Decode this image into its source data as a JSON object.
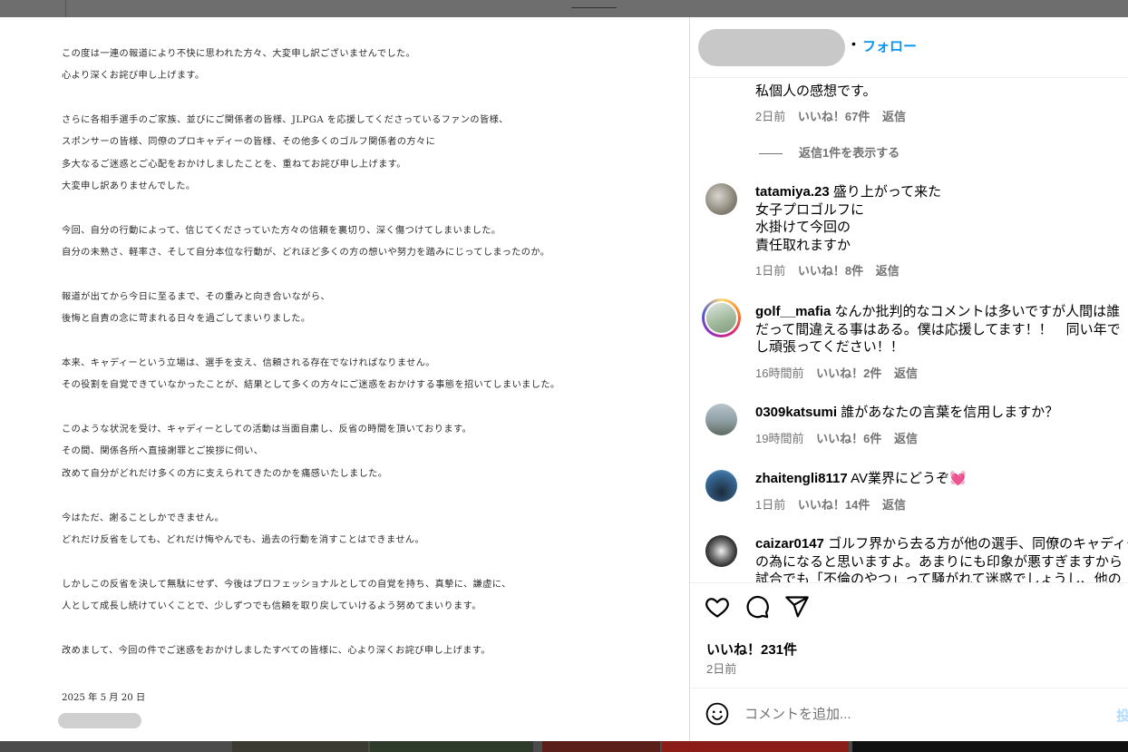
{
  "document": {
    "paragraphs": [
      [
        "この度は一連の報道により不快に思われた方々、大変申し訳ございませんでした。",
        "心より深くお詫び申し上げます。"
      ],
      [
        "さらに各相手選手のご家族、並びにご関係者の皆様、JLPGA を応援してくださっているファンの皆様、",
        "スポンサーの皆様、同僚のプロキャディーの皆様、その他多くのゴルフ関係者の方々に",
        "多大なるご迷惑とご心配をおかけしましたことを、重ねてお詫び申し上げます。",
        "大変申し訳ありませんでした。"
      ],
      [
        "今回、自分の行動によって、信じてくださっていた方々の信頼を裏切り、深く傷つけてしまいました。",
        "自分の未熟さ、軽率さ、そして自分本位な行動が、どれほど多くの方の想いや努力を踏みにじってしまったのか。"
      ],
      [
        "報道が出てから今日に至るまで、その重みと向き合いながら、",
        "後悔と自責の念に苛まれる日々を過ごしてまいりました。"
      ],
      [
        "本来、キャディーという立場は、選手を支え、信頼される存在でなければなりません。",
        "その役割を自覚できていなかったことが、結果として多くの方々にご迷惑をおかけする事態を招いてしまいました。"
      ],
      [
        "このような状況を受け、キャディーとしての活動は当面自粛し、反省の時間を頂いております。",
        "その間、関係各所へ直接謝罪とご挨拶に伺い、",
        "改めて自分がどれだけ多くの方に支えられてきたのかを痛感いたしました。"
      ],
      [
        "今はただ、謝ることしかできません。",
        "どれだけ反省をしても、どれだけ悔やんでも、過去の行動を消すことはできません。"
      ],
      [
        "しかしこの反省を決して無駄にせず、今後はプロフェッショナルとしての自覚を持ち、真摯に、謙虚に、",
        "人として成長し続けていくことで、少しずつでも信頼を取り戻していけるよう努めてまいります。"
      ],
      [
        "改めまして、今回の件でご迷惑をおかけしましたすべての皆様に、心より深くお詫び申し上げます。"
      ]
    ],
    "date": "2025 年 5 月 20 日"
  },
  "header": {
    "dot": "•",
    "follow": "フォロー"
  },
  "comments": {
    "partial": {
      "text": "私個人の感想です。",
      "time": "2日前",
      "likes": "いいね！67件",
      "reply": "返信"
    },
    "view_replies": "返信1件を表示する",
    "items": [
      {
        "user": "tatamiya.23",
        "lines": [
          "盛り上がって来た",
          "女子プロゴルフに",
          "水掛けて今回の",
          "責任取れますか"
        ],
        "time": "1日前",
        "likes": "いいね！8件",
        "reply": "返信"
      },
      {
        "user": "golf__mafia",
        "lines": [
          "なんか批判的なコメントは多いですが人間は誰",
          "だって間違える事はある。僕は応援してます！！　同い年で",
          "し頑張ってください！！"
        ],
        "time": "16時間前",
        "likes": "いいね！2件",
        "reply": "返信"
      },
      {
        "user": "0309katsumi",
        "lines": [
          "誰があなたの言葉を信用しますか？"
        ],
        "time": "19時間前",
        "likes": "いいね！6件",
        "reply": "返信"
      },
      {
        "user": "zhaitengli8117",
        "lines": [
          "AV業界にどうぞ💓"
        ],
        "time": "1日前",
        "likes": "いいね！14件",
        "reply": "返信"
      },
      {
        "user": "caizar0147",
        "lines": [
          "ゴルフ界から去る方が他の選手、同僚のキャディー",
          "の為になると思いますよ。あまりにも印象が悪すぎますから",
          "試合でも「不倫のやつ」って騒がれて迷惑でしょうし、他の"
        ],
        "time": "",
        "likes": "",
        "reply": ""
      }
    ]
  },
  "post": {
    "likes": "いいね！231件",
    "time": "2日前"
  },
  "add_comment": {
    "placeholder": "コメントを追加...",
    "post_label": "投稿する"
  },
  "icons": {
    "like": "heart-icon",
    "comment": "comment-icon",
    "share": "paper-plane-icon",
    "emoji": "emoji-icon"
  }
}
